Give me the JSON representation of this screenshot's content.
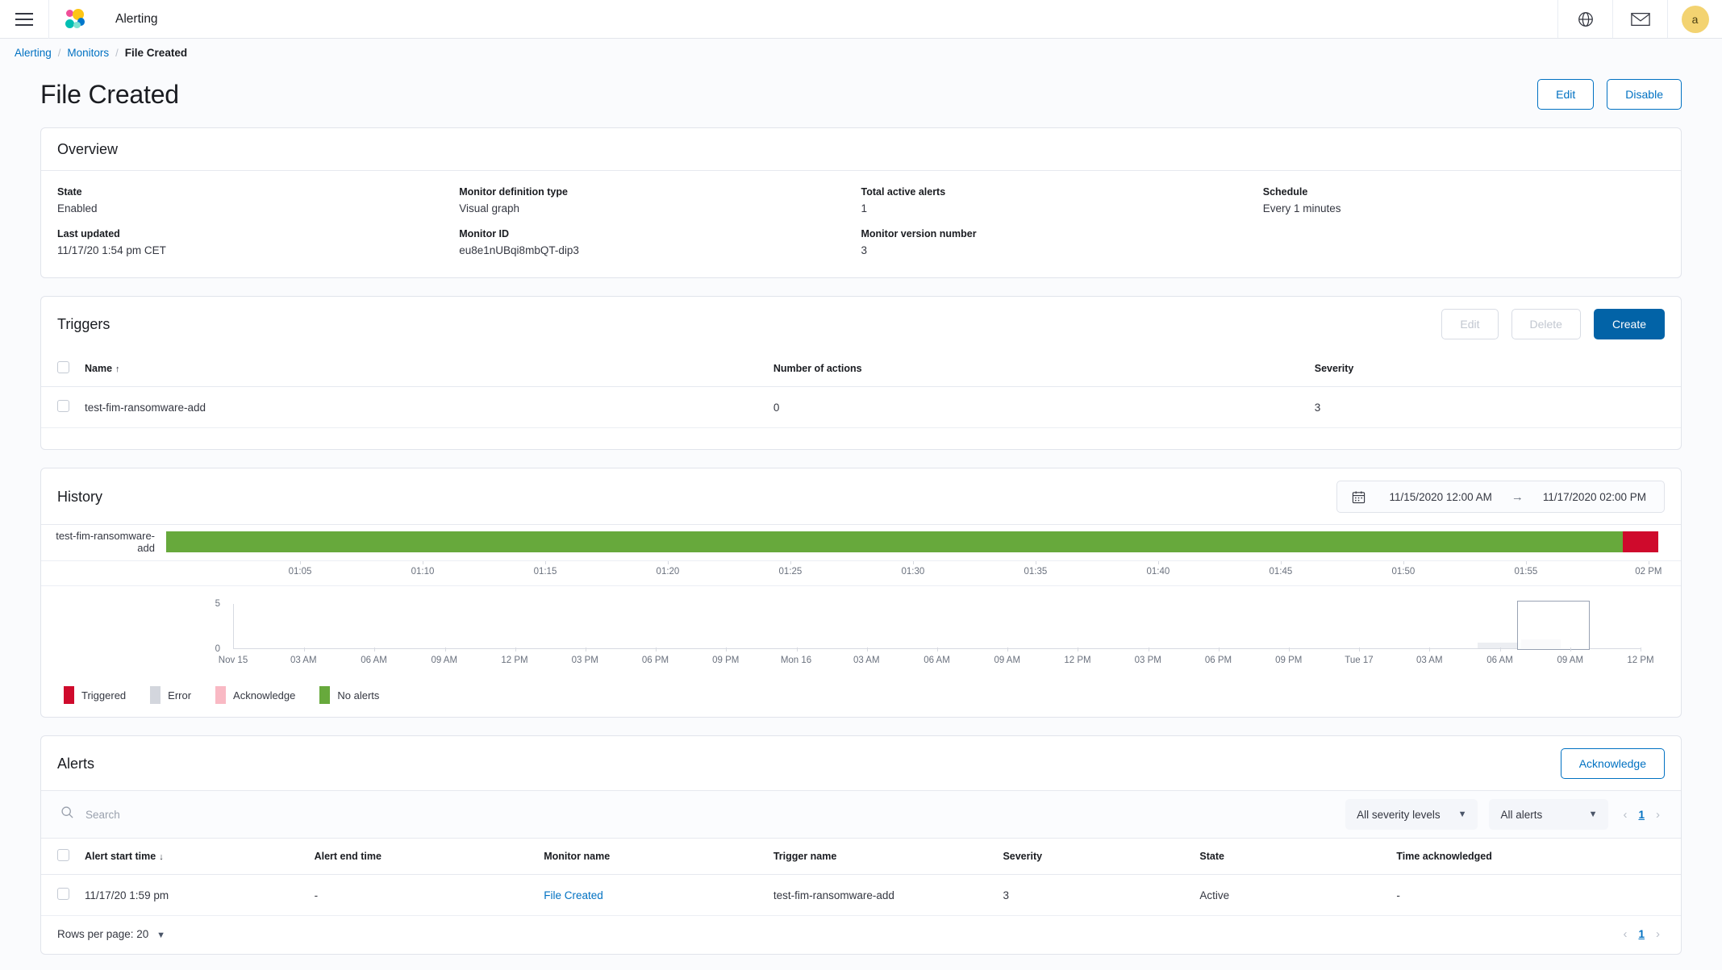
{
  "chrome": {
    "app_title": "Alerting",
    "menu_icon": "hamburger-menu-icon",
    "logo_icon": "elastic-logo-icon",
    "globe_icon": "globe-icon",
    "mail_icon": "mail-icon",
    "avatar_initial": "a"
  },
  "breadcrumb": {
    "items": [
      "Alerting",
      "Monitors",
      "File Created"
    ]
  },
  "header": {
    "title": "File Created",
    "edit_label": "Edit",
    "disable_label": "Disable"
  },
  "overview": {
    "title": "Overview",
    "fields": [
      {
        "label": "State",
        "value": "Enabled"
      },
      {
        "label": "Monitor definition type",
        "value": "Visual graph"
      },
      {
        "label": "Total active alerts",
        "value": "1"
      },
      {
        "label": "Schedule",
        "value": "Every 1 minutes"
      },
      {
        "label": "Last updated",
        "value": "11/17/20 1:54 pm CET"
      },
      {
        "label": "Monitor ID",
        "value": "eu8e1nUBqi8mbQT-dip3"
      },
      {
        "label": "Monitor version number",
        "value": "3"
      },
      {
        "label": "",
        "value": ""
      }
    ]
  },
  "triggers": {
    "title": "Triggers",
    "edit_label": "Edit",
    "delete_label": "Delete",
    "create_label": "Create",
    "columns": [
      "Name",
      "Number of actions",
      "Severity"
    ],
    "sort_indicator": "↑",
    "rows": [
      {
        "name": "test-fim-ransomware-add",
        "actions": "0",
        "severity": "3"
      }
    ]
  },
  "history": {
    "title": "History",
    "calendar_icon": "calendar-icon",
    "start": "11/15/2020 12:00 AM",
    "arrow": "→",
    "end": "11/17/2020 02:00 PM",
    "row_label": "test-fim-ransomware-add",
    "legend": [
      {
        "label": "Triggered",
        "color": "#cf0a2c"
      },
      {
        "label": "Error",
        "color": "#d3d6dd"
      },
      {
        "label": "Acknowledge",
        "color": "#f9b9c4"
      },
      {
        "label": "No alerts",
        "color": "#67a93c"
      }
    ],
    "timeline": {
      "segments": [
        {
          "state": "No alerts",
          "color": "#67a93c",
          "pct": 97.6
        },
        {
          "state": "Triggered",
          "color": "#cf0a2c",
          "pct": 2.4
        }
      ],
      "ticks": [
        "01:05",
        "01:10",
        "01:15",
        "01:20",
        "01:25",
        "01:30",
        "01:35",
        "01:40",
        "01:45",
        "01:50",
        "01:55",
        "02 PM"
      ]
    },
    "mini_chart": {
      "y_ticks": [
        "5",
        "0"
      ],
      "x_ticks": [
        "Nov 15",
        "03 AM",
        "06 AM",
        "09 AM",
        "12 PM",
        "03 PM",
        "06 PM",
        "09 PM",
        "Mon 16",
        "03 AM",
        "06 AM",
        "09 AM",
        "12 PM",
        "03 PM",
        "06 PM",
        "09 PM",
        "Tue 17",
        "03 AM",
        "06 AM",
        "09 AM",
        "12 PM"
      ]
    }
  },
  "alerts": {
    "title": "Alerts",
    "acknowledge_label": "Acknowledge",
    "search_placeholder": "Search",
    "search_value": "",
    "search_icon": "search-icon",
    "severity_filter": "All severity levels",
    "alerts_filter": "All alerts",
    "page_number": "1",
    "prev_icon": "chevron-left-icon",
    "next_icon": "chevron-right-icon",
    "columns": [
      "Alert start time",
      "Alert end time",
      "Monitor name",
      "Trigger name",
      "Severity",
      "State",
      "Time acknowledged"
    ],
    "sort_indicator": "↓",
    "rows": [
      {
        "start": "11/17/20 1:59 pm",
        "end": "-",
        "monitor": "File Created",
        "trigger": "test-fim-ransomware-add",
        "severity": "3",
        "state": "Active",
        "acknowledged": "-"
      }
    ],
    "rows_per_page": "Rows per page: 20",
    "footer_page_number": "1"
  },
  "colors": {
    "accent": "#0071c2",
    "primary_button": "#0263a7",
    "green": "#67a93c",
    "red": "#cf0a2c"
  }
}
